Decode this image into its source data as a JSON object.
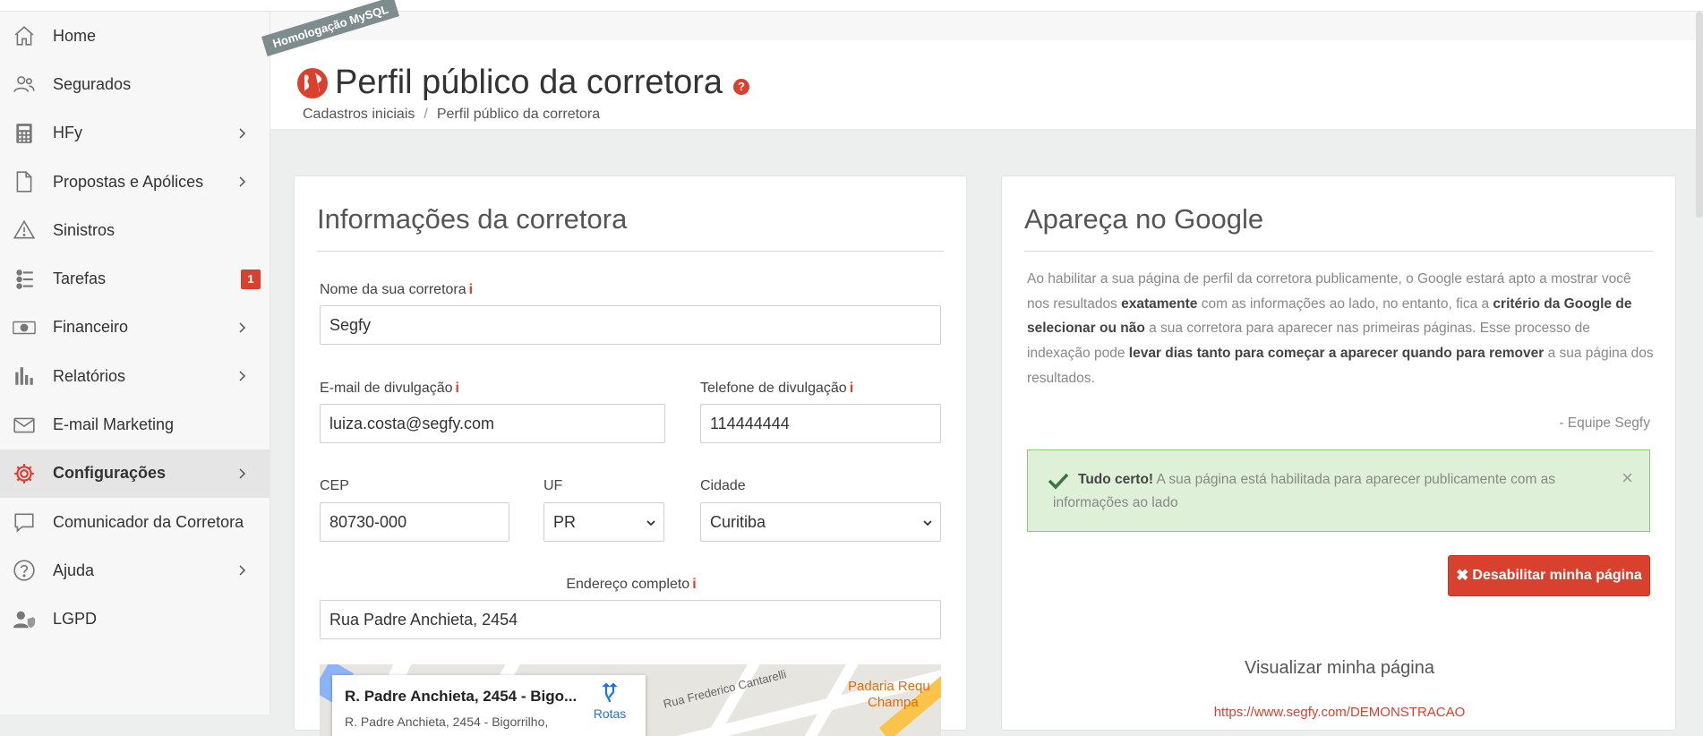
{
  "sidebar": {
    "items": [
      {
        "label": "Home",
        "icon": "home-icon",
        "chevron": false
      },
      {
        "label": "Segurados",
        "icon": "users-icon",
        "chevron": false
      },
      {
        "label": "HFy",
        "icon": "calculator-icon",
        "chevron": true
      },
      {
        "label": "Propostas e Apólices",
        "icon": "document-icon",
        "chevron": true
      },
      {
        "label": "Sinistros",
        "icon": "warning-icon",
        "chevron": false
      },
      {
        "label": "Tarefas",
        "icon": "tasks-icon",
        "chevron": false,
        "badge": "1"
      },
      {
        "label": "Financeiro",
        "icon": "money-icon",
        "chevron": true
      },
      {
        "label": "Relatórios",
        "icon": "bar-chart-icon",
        "chevron": true
      },
      {
        "label": "E-mail Marketing",
        "icon": "mail-icon",
        "chevron": false
      },
      {
        "label": "Configurações",
        "icon": "gear-icon",
        "chevron": true,
        "active": true
      },
      {
        "label": "Comunicador da Corretora",
        "icon": "chat-icon",
        "chevron": false
      },
      {
        "label": "Ajuda",
        "icon": "help-icon",
        "chevron": true
      },
      {
        "label": "LGPD",
        "icon": "user-shield-icon",
        "chevron": false
      }
    ]
  },
  "header": {
    "ribbon": "Homologação MySQL",
    "title": "Perfil público da corretora",
    "help": "?",
    "breadcrumb": [
      "Cadastros iniciais",
      "Perfil público da corretora"
    ],
    "breadcrumb_sep": "/"
  },
  "form": {
    "title": "Informações da corretora",
    "name_label": "Nome da sua corretora",
    "name_value": "Segfy",
    "email_label": "E-mail de divulgação",
    "email_value": "luiza.costa@segfy.com",
    "phone_label": "Telefone de divulgação",
    "phone_value": "114444444",
    "cep_label": "CEP",
    "cep_value": "80730-000",
    "uf_label": "UF",
    "uf_value": "PR",
    "city_label": "Cidade",
    "city_value": "Curitiba",
    "address_label": "Endereço completo",
    "address_value": "Rua Padre Anchieta, 2454",
    "info_glyph": "i"
  },
  "map": {
    "card_title": "R. Padre Anchieta, 2454 - Bigo...",
    "card_sub": "R. Padre Anchieta, 2454 - Bigorrilho,",
    "routes_label": "Rotas",
    "street_label": "Rua Frederico Cantarelli",
    "poi_label_1": "Padaria Requ",
    "poi_label_2": "Champa"
  },
  "google": {
    "title": "Apareça no Google",
    "p1": "Ao habilitar a sua página de perfil da corretora publicamente, o Google estará apto a mostrar você nos resultados ",
    "b1": "exatamente",
    "p2": " com as informações ao lado, no entanto, fica a ",
    "b2": "critério da Google de selecionar ou não",
    "p3": " a sua corretora para aparecer nas primeiras páginas. Esse processo de indexação pode ",
    "b3": "levar dias tanto para começar a aparecer quando para remover",
    "p4": " a sua página dos resultados.",
    "signature": "- Equipe Segfy",
    "alert_bold": "Tudo certo!",
    "alert_text": " A sua página está habilitada para aparecer publicamente com as informações ao lado",
    "alert_close": "×",
    "disable_button": "Desabilitar minha página",
    "disable_glyph": "✖",
    "view_title": "Visualizar minha página",
    "view_link": "https://www.segfy.com/DEMONSTRACAO"
  },
  "colors": {
    "accent": "#d9412f",
    "success_bg": "#dff0d8",
    "ribbon": "#7f8c8d"
  }
}
